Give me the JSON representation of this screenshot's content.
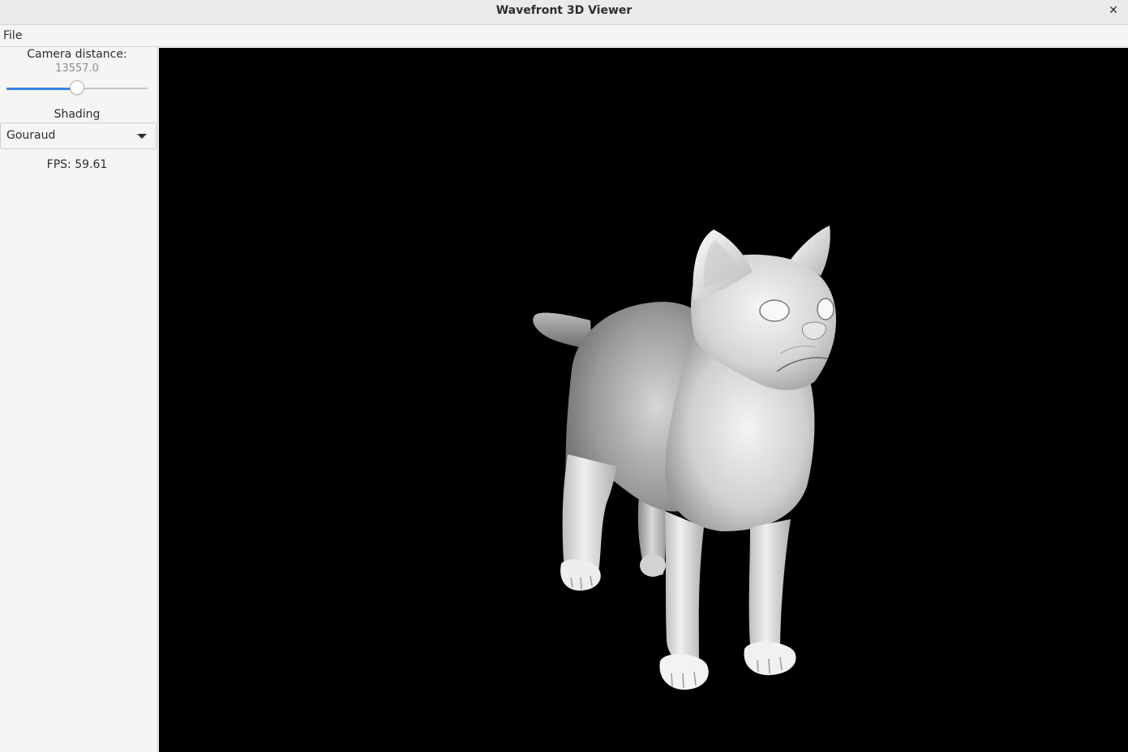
{
  "window": {
    "title": "Wavefront 3D Viewer",
    "close_glyph": "✕"
  },
  "menubar": {
    "items": [
      {
        "label": "File"
      }
    ]
  },
  "sidebar": {
    "camera": {
      "label": "Camera distance:",
      "value": "13557.0",
      "slider_fraction": 0.5
    },
    "shading": {
      "label": "Shading",
      "selected": "Gouraud"
    },
    "fps": "FPS: 59.61"
  },
  "viewport": {
    "background": "#000000",
    "model": "cat"
  },
  "colors": {
    "accent": "#3584e4",
    "model_light": "#f2f2f2",
    "model_dark": "#5e5e5e"
  }
}
